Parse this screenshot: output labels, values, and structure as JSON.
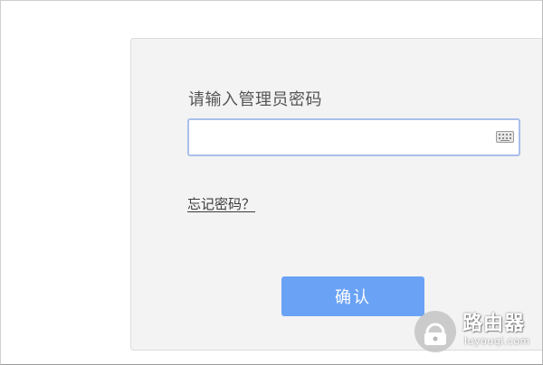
{
  "login": {
    "prompt": "请输入管理员密码",
    "password_value": "",
    "forgot_link": "忘记密码？",
    "confirm_label": "确认"
  },
  "icons": {
    "keyboard": "keyboard-icon",
    "watermark_logo": "router-lock-icon"
  },
  "watermark": {
    "title": "路由器",
    "subtitle": "luyouqi.com"
  },
  "colors": {
    "button": "#6aa2f5",
    "input_border": "#a9bfea",
    "panel": "#f3f3f3"
  }
}
